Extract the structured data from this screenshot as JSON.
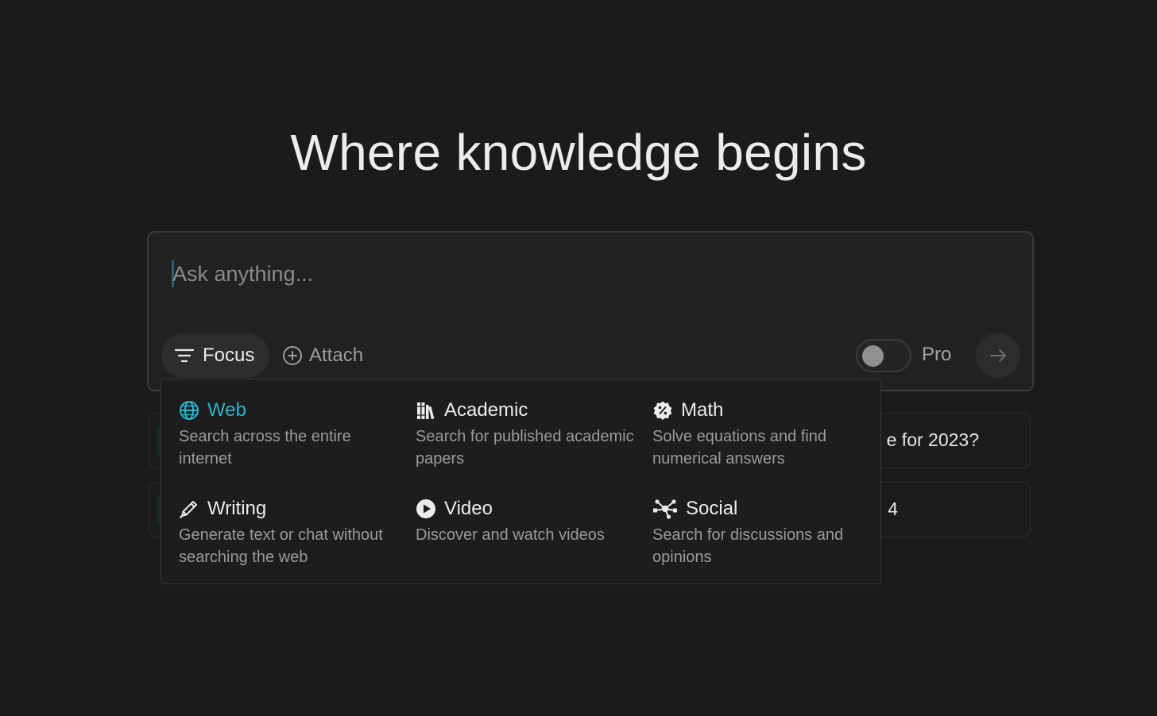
{
  "headline": "Where knowledge begins",
  "search": {
    "placeholder": "Ask anything...",
    "focus_label": "Focus",
    "attach_label": "Attach",
    "pro_label": "Pro",
    "pro_enabled": false
  },
  "suggestions": [
    {
      "visible_text": "e for 2023?"
    },
    {
      "visible_text": "4"
    }
  ],
  "focus_menu": {
    "options": [
      {
        "id": "web",
        "title": "Web",
        "description": "Search across the entire internet",
        "icon": "globe-icon",
        "active": true
      },
      {
        "id": "academic",
        "title": "Academic",
        "description": "Search for published academic papers",
        "icon": "books-icon",
        "active": false
      },
      {
        "id": "math",
        "title": "Math",
        "description": "Solve equations and find numerical answers",
        "icon": "percent-badge-icon",
        "active": false
      },
      {
        "id": "writing",
        "title": "Writing",
        "description": "Generate text or chat without searching the web",
        "icon": "pencil-icon",
        "active": false
      },
      {
        "id": "video",
        "title": "Video",
        "description": "Discover and watch videos",
        "icon": "play-icon",
        "active": false
      },
      {
        "id": "social",
        "title": "Social",
        "description": "Search for discussions and opinions",
        "icon": "network-icon",
        "active": false
      }
    ]
  },
  "colors": {
    "background": "#1a1b1b",
    "accent": "#2bb4d0",
    "panel": "#202121",
    "muted_text": "#9a9c9b"
  }
}
